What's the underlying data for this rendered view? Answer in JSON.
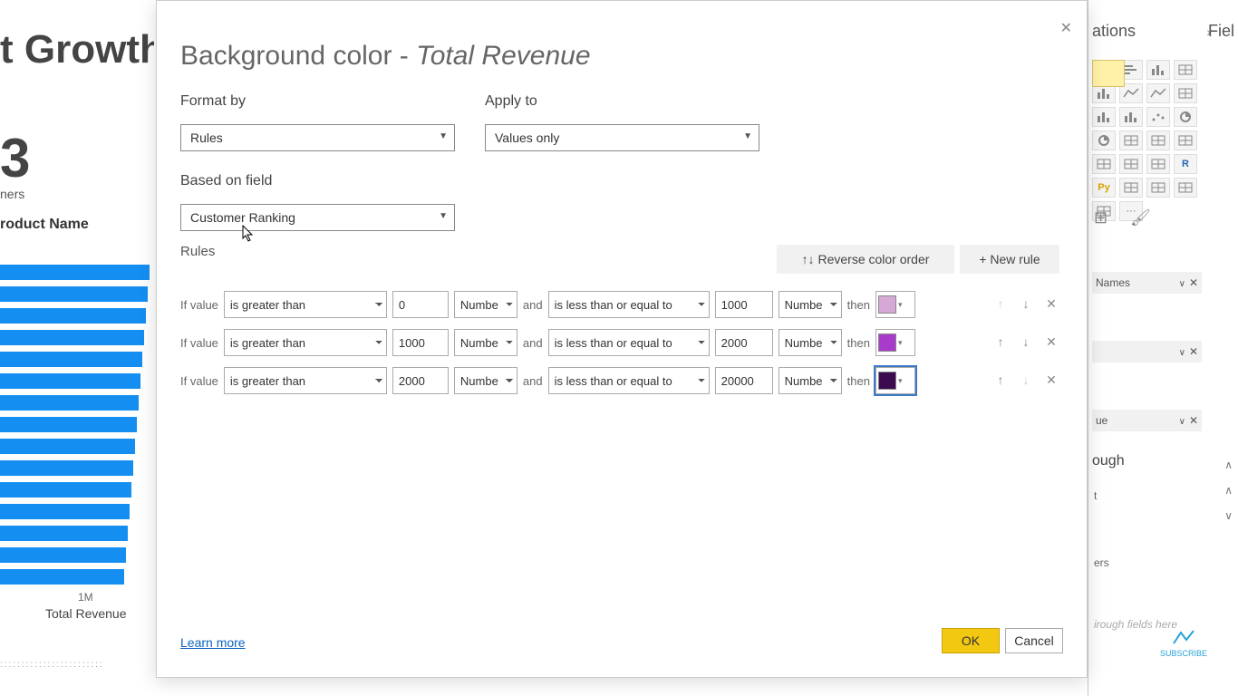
{
  "bg": {
    "title": "t Growth",
    "bigNumber": "3",
    "sub": "ners",
    "axisLabel": "roduct Name",
    "xTick": "1M",
    "xTitle": "Total Revenue",
    "bars": [
      165,
      163,
      161,
      159,
      157,
      155,
      153,
      151,
      149,
      147,
      145,
      143,
      141,
      139,
      137
    ]
  },
  "panel": {
    "header": "ations",
    "fieldsHeader": "Fiel",
    "fieldRows": {
      "names": "Names",
      "blank1": "",
      "value": "ue",
      "drillLabel": "ough",
      "drillItem1": "t",
      "drillItem2": "ers",
      "drillText": "irough fields here"
    }
  },
  "dialog": {
    "title_prefix": "Background color - ",
    "title_field": "Total Revenue",
    "formatByLabel": "Format by",
    "formatByValue": "Rules",
    "applyToLabel": "Apply to",
    "applyToValue": "Values only",
    "basedOnLabel": "Based on field",
    "basedOnValue": "Customer Ranking",
    "rulesLabel": "Rules",
    "reverseLabel": "Reverse color order",
    "newRuleLabel": "New rule",
    "ifValue": "If value",
    "and": "and",
    "then": "then",
    "op_gt": "is greater than",
    "op_lte": "is less than or equal to",
    "numType": "Number",
    "rules": [
      {
        "minVal": "0",
        "maxVal": "1000",
        "color": "#d6a8d6",
        "selected": false,
        "upDisabled": true,
        "downDisabled": false
      },
      {
        "minVal": "1000",
        "maxVal": "2000",
        "color": "#a93bcb",
        "selected": false,
        "upDisabled": false,
        "downDisabled": false
      },
      {
        "minVal": "2000",
        "maxVal": "20000",
        "color": "#3b0a4f",
        "selected": true,
        "upDisabled": false,
        "downDisabled": true
      }
    ],
    "learnMore": "Learn more",
    "ok": "OK",
    "cancel": "Cancel"
  },
  "subscribe": "SUBSCRIBE"
}
